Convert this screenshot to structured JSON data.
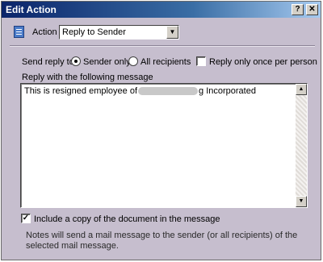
{
  "window": {
    "title": "Edit Action",
    "help_label": "?",
    "close_label": "✕"
  },
  "action": {
    "label": "Action",
    "selected": "Reply to Sender",
    "dropdown_glyph": "▼"
  },
  "send_reply": {
    "label": "Send reply to:",
    "options": [
      {
        "label": "Sender only",
        "selected": true
      },
      {
        "label": "All recipients",
        "selected": false
      }
    ],
    "once_per_person": {
      "label": "Reply only once per person",
      "checked": false
    }
  },
  "message": {
    "label": "Reply with the following message",
    "text_before": "This is resigned employee of",
    "text_after": "g Incorporated",
    "scroll_up": "▲",
    "scroll_down": "▼"
  },
  "include_copy": {
    "label": "Include a copy of the document in the message",
    "checked": true,
    "check_glyph": "✓"
  },
  "info": {
    "text": "Notes will send a mail message to the sender (or all recipients) of the selected mail message."
  },
  "icons": [
    "document-icon",
    "help-icon",
    "close-icon",
    "chevron-down-icon"
  ]
}
